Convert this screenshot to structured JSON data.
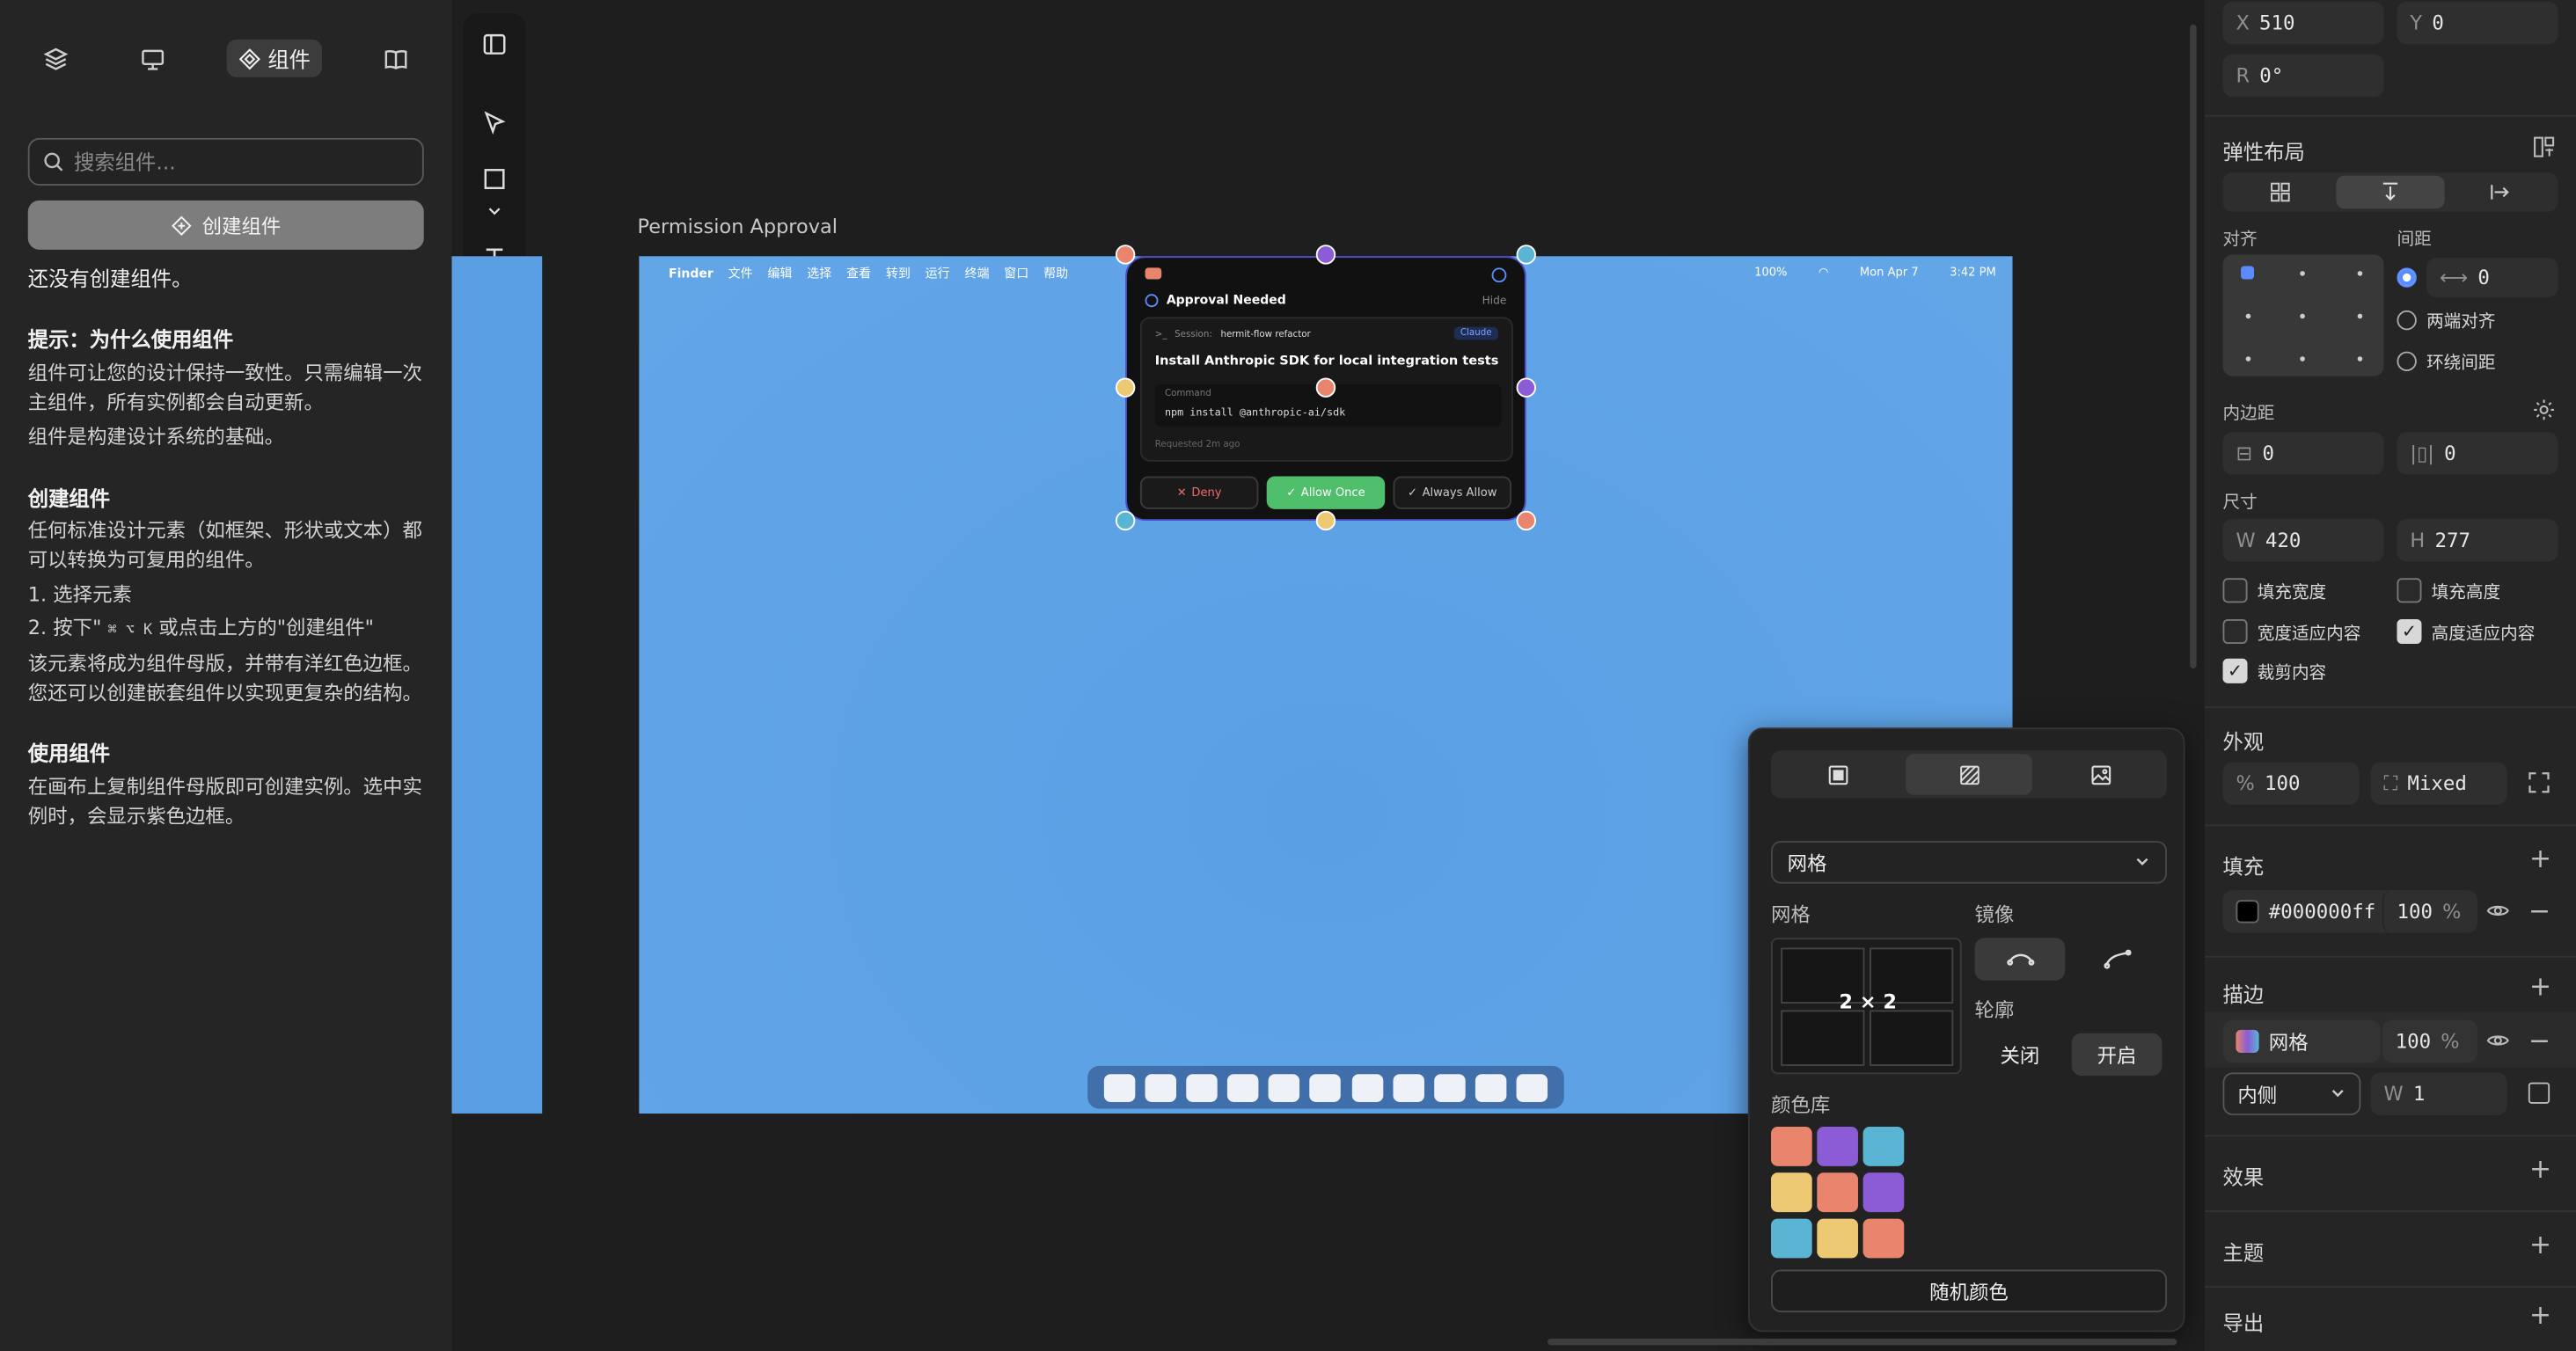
{
  "left_panel": {
    "tabs": {
      "active_label": "组件"
    },
    "search_placeholder": "搜索组件...",
    "create_button": "创建组件",
    "empty_text": "还没有创建组件。",
    "tip_title": "提示：为什么使用组件",
    "tip_p1": "组件可让您的设计保持一致性。只需编辑一次主组件，所有实例都会自动更新。",
    "tip_p2": "组件是构建设计系统的基础。",
    "create_title": "创建组件",
    "create_p1": "任何标准设计元素（如框架、形状或文本）都可以转换为可复用的组件。",
    "step1": "1. 选择元素",
    "step2_pre": "2. 按下\"",
    "step2_keys": "⌘ ⌥ K",
    "step2_post": "或点击上方的\"创建组件\"",
    "create_p2": "该元素将成为组件母版，并带有洋红色边框。您还可以创建嵌套组件以实现更复杂的结构。",
    "use_title": "使用组件",
    "use_p1": "在画布上复制组件母版即可创建实例。选中实例时，会显示紫色边框。"
  },
  "canvas": {
    "frame_label": "Permission Approval",
    "menubar": {
      "items": [
        "Finder",
        "文件",
        "编辑",
        "选择",
        "查看",
        "转到",
        "运行",
        "终端",
        "窗口",
        "帮助"
      ],
      "battery": "100%",
      "date": "Mon Apr 7",
      "time": "3:42 PM"
    },
    "approval": {
      "title": "Approval Needed",
      "hide": "Hide",
      "session_label": "Session:",
      "session_name": "hermit-flow refactor",
      "badge": "Claude",
      "heading": "Install Anthropic SDK for local integration tests",
      "command_label": "Command",
      "command": "npm install @anthropic-ai/sdk",
      "requested": "Requested 2m ago",
      "deny": "Deny",
      "allow_once": "Allow Once",
      "always_allow": "Always Allow"
    }
  },
  "fill_popup": {
    "pattern_select": "网格",
    "grid_label": "网格",
    "grid_value": "2 × 2",
    "mirror_label": "镜像",
    "outline_label": "轮廓",
    "outline_off": "关闭",
    "outline_on": "开启",
    "palette_label": "颜色库",
    "random_button": "随机颜色",
    "palette": [
      "#e8856c",
      "#8b5cd6",
      "#5ab4d4",
      "#eec973",
      "#e8856c",
      "#8b5cd6",
      "#5ab4d4",
      "#eec973",
      "#e8856c"
    ]
  },
  "right_panel": {
    "x_label": "X",
    "x": "510",
    "y_label": "Y",
    "y": "0",
    "r_label": "R",
    "r": "0°",
    "flex_title": "弹性布局",
    "align_label": "对齐",
    "gap_label": "间距",
    "gap_value": "0",
    "justify": "两端对齐",
    "around": "环绕间距",
    "padding_label": "内边距",
    "pad_h": "0",
    "pad_v": "0",
    "size_label": "尺寸",
    "w_label": "W",
    "w": "420",
    "h_label": "H",
    "h": "277",
    "fill_width": "填充宽度",
    "fill_height": "填充高度",
    "hug_width": "宽度适应内容",
    "hug_height": "高度适应内容",
    "clip": "裁剪内容",
    "appearance_title": "外观",
    "opacity_prefix": "%",
    "opacity": "100",
    "radius_value": "Mixed",
    "fill_title": "填充",
    "fill_hex": "#000000ff",
    "fill_opacity": "100",
    "fill_pct": "%",
    "stroke_title": "描边",
    "stroke_name": "网格",
    "stroke_opacity": "100",
    "stroke_pct": "%",
    "stroke_position": "内侧",
    "stroke_w_label": "W",
    "stroke_w": "1",
    "effects_title": "效果",
    "theme_title": "主题",
    "export_title": "导出"
  }
}
